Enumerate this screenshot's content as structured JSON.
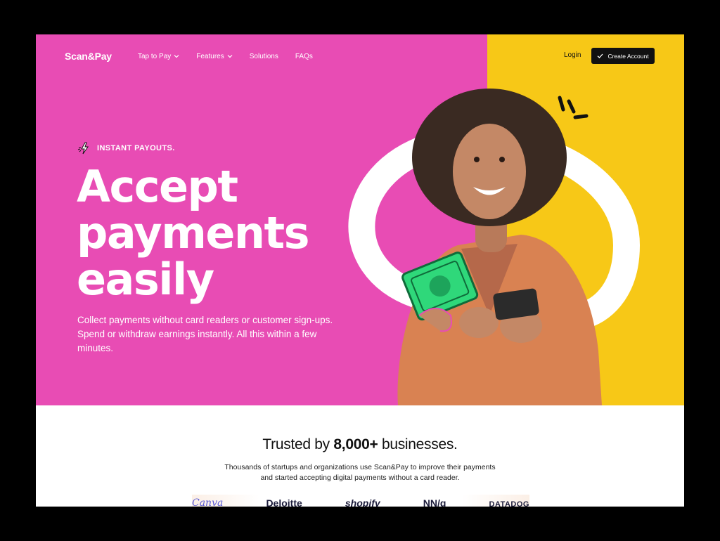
{
  "brand": {
    "logo": "Scan&Pay"
  },
  "nav": {
    "items": [
      {
        "label": "Tap to Pay",
        "has_dropdown": true
      },
      {
        "label": "Features",
        "has_dropdown": true
      },
      {
        "label": "Solutions",
        "has_dropdown": false
      },
      {
        "label": "FAQs",
        "has_dropdown": false
      }
    ],
    "login": "Login",
    "cta": "Create Account"
  },
  "hero": {
    "badge": "INSTANT PAYOUTS.",
    "headline": [
      "Accept",
      "payments",
      "easily"
    ],
    "subtext": "Collect payments without card readers or customer sign-ups. Spend or withdraw earnings instantly. All this within a few minutes."
  },
  "trusted": {
    "prefix": "Trusted by",
    "count": "8,000+",
    "suffix": "businesses.",
    "sub_line1": "Thousands of startups and organizations use Scan&Pay to improve their payments",
    "sub_line2": "and started accepting digital payments without a card reader."
  },
  "partner_logos": [
    "Canva",
    "Deloitte",
    "shopify",
    "NN/g",
    "DATADOG"
  ],
  "colors": {
    "pink": "#e84cb4",
    "yellow": "#f7c817",
    "dark": "#111111",
    "money_green": "#2fd87a"
  },
  "icons": [
    "chevron-down-icon",
    "check-icon",
    "lightning-icon",
    "phone-icon",
    "money-icon"
  ]
}
